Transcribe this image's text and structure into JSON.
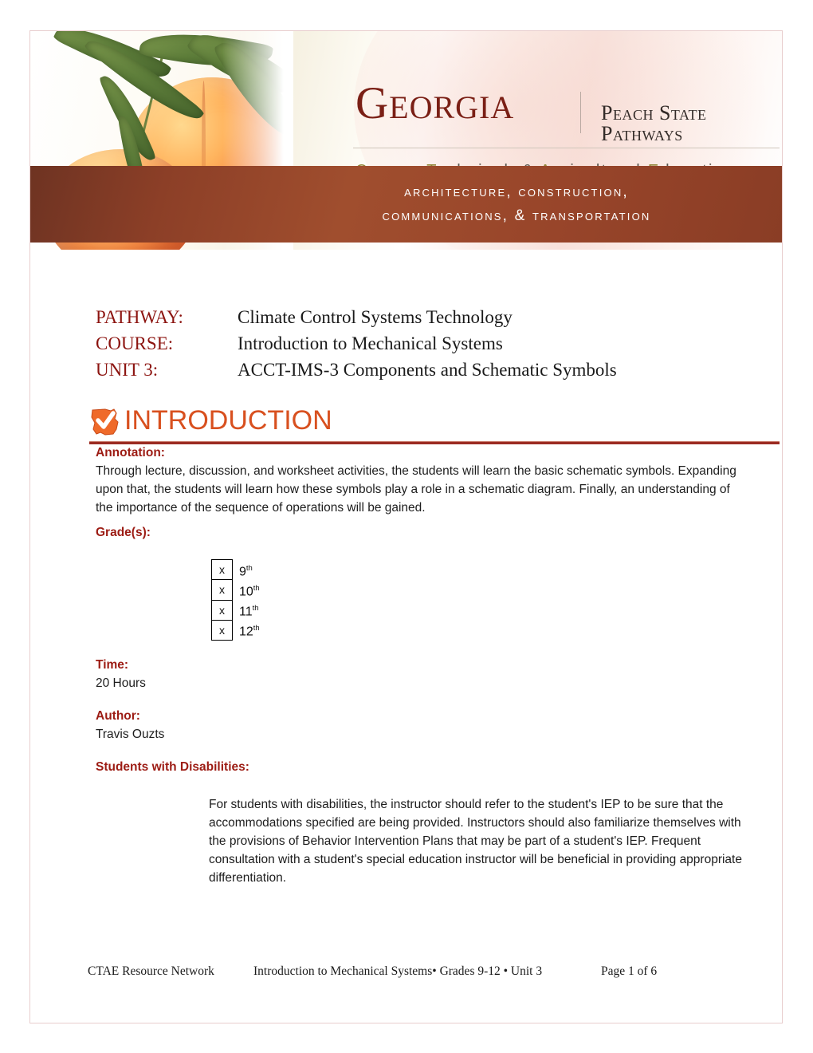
{
  "banner": {
    "state_name": "Georgia",
    "tagline": "Peach State Pathways",
    "subtitle_parts": [
      {
        "cap": "C",
        "rest": "areer, "
      },
      {
        "cap": "T",
        "rest": "echnical, & "
      },
      {
        "cap": "A",
        "rest": "gricultural "
      },
      {
        "cap": "E",
        "rest": "ducation"
      }
    ],
    "cluster_line_1": "Architecture, Construction,",
    "cluster_line_2": "Communications, & transportation",
    "colors": {
      "band": "#a04e2e",
      "georgia_text": "#7a1f15",
      "cap_accent": "#8f8333"
    }
  },
  "meta": {
    "pathway_label": "PATHWAY:",
    "pathway_value": "Climate Control Systems Technology",
    "course_label": "COURSE:",
    "course_value": "Introduction to Mechanical Systems",
    "unit_label": "UNIT 3:",
    "unit_value": "ACCT-IMS-3 Components and Schematic Symbols"
  },
  "section": {
    "icon": "georgia-check-icon",
    "title": "INTRODUCTION",
    "title_color": "#d8501f",
    "rule_color": "#9b2b22"
  },
  "annotation": {
    "label": "Annotation:",
    "text": "Through lecture, discussion, and worksheet activities, the students will learn the basic schematic symbols. Expanding upon that, the students will learn how these symbols play a role in a schematic diagram. Finally, an understanding of the importance of the sequence of operations will be gained."
  },
  "grades": {
    "label": "Grade(s):",
    "rows": [
      {
        "mark": "x",
        "grade": "9",
        "suffix": "th"
      },
      {
        "mark": "x",
        "grade": "10",
        "suffix": "th"
      },
      {
        "mark": "x",
        "grade": "11",
        "suffix": "th"
      },
      {
        "mark": "x",
        "grade": "12",
        "suffix": "th"
      }
    ]
  },
  "time": {
    "label": "Time:",
    "value": "20 Hours"
  },
  "author": {
    "label": "Author:",
    "value": "Travis Ouzts"
  },
  "disabilities": {
    "label": "Students with Disabilities:",
    "text": "For students with disabilities, the instructor should refer to the student's IEP to be sure that the accommodations specified are being provided. Instructors should also familiarize themselves with the provisions of Behavior Intervention Plans that may be part of a student's IEP. Frequent consultation with a student's special education instructor will be beneficial in providing appropriate differentiation."
  },
  "footer": {
    "left": "CTAE Resource Network",
    "center": "Introduction to Mechanical Systems• Grades 9-12 • Unit 3",
    "right": "Page 1 of 6"
  }
}
